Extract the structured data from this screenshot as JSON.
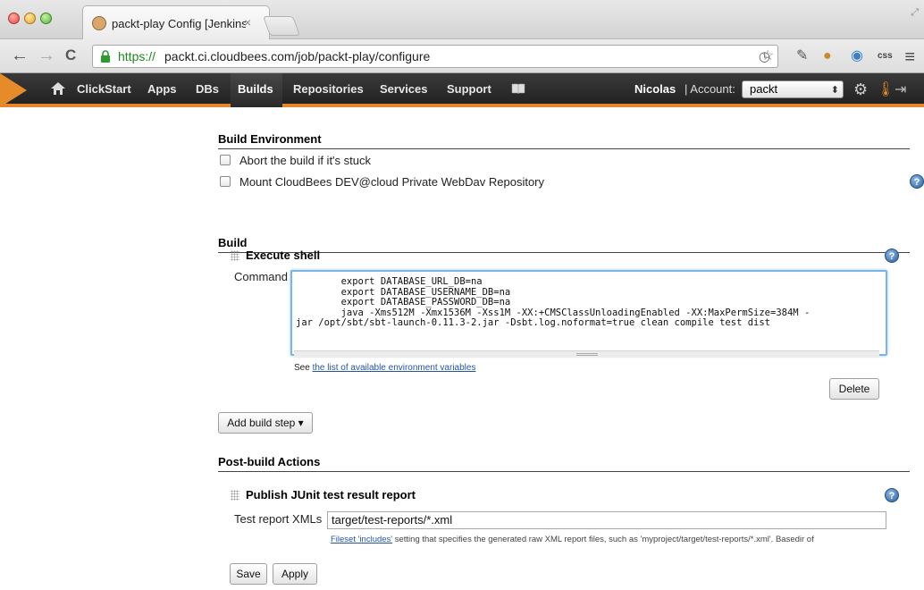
{
  "browser": {
    "tab_title": "packt-play Config [Jenkins",
    "tab_close": "×",
    "url_protocol": "https://",
    "url_rest": "packt.ci.cloudbees.com/job/packt-play/configure",
    "back": "←",
    "forward": "→",
    "reload": "C",
    "menu": "≡"
  },
  "appnav": {
    "items": [
      "ClickStart",
      "Apps",
      "DBs",
      "Builds",
      "Repositories",
      "Services",
      "Support"
    ],
    "active": "Builds",
    "user": "Nicolas",
    "account_label": "| Account:",
    "account_value": "packt",
    "accent_color": "#e6862a"
  },
  "build_environment": {
    "header": "Build Environment",
    "options": [
      {
        "label": "Abort the build if it's stuck",
        "checked": false
      },
      {
        "label": "Mount CloudBees DEV@cloud Private WebDav Repository",
        "checked": false
      }
    ]
  },
  "build": {
    "header": "Build",
    "step_title": "Execute shell",
    "command_label": "Command",
    "command": "        export DATABASE_URL_DB=na\n        export DATABASE_USERNAME_DB=na\n        export DATABASE_PASSWORD_DB=na\n        java -Xms512M -Xmx1536M -Xss1M -XX:+CMSClassUnloadingEnabled -XX:MaxPermSize=384M -\njar /opt/sbt/sbt-launch-0.11.3-2.jar -Dsbt.log.noformat=true clean compile test dist",
    "env_prefix": "See ",
    "env_link": "the list of available environment variables",
    "delete_label": "Delete",
    "add_step_label": "Add build step ▾"
  },
  "post_build": {
    "header": "Post-build Actions",
    "step_title": "Publish JUnit test result report",
    "xml_label": "Test report XMLs",
    "xml_value": "target/test-reports/*.xml",
    "fileset_link": "Fileset 'includes'",
    "fileset_text": " setting that specifies the generated raw XML report files, such as 'myproject/target/test-reports/*.xml'. Basedir of"
  },
  "footer": {
    "save_label": "Save",
    "apply_label": "Apply"
  },
  "help_glyph": "?"
}
